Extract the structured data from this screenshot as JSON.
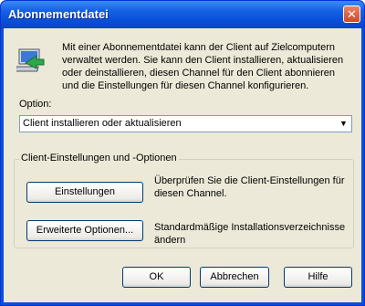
{
  "window": {
    "title": "Abonnementdatei",
    "close_label": "✕"
  },
  "description": "Mit einer Abonnementdatei kann der Client auf Zielcomputern verwaltet werden. Sie kann den Client installieren, aktualisieren oder deinstallieren, diesen Channel für den Client abonnieren und die Einstellungen für diesen Channel konfigurieren.",
  "option": {
    "label": "Option:",
    "selected": "Client installieren oder aktualisieren"
  },
  "group": {
    "label": "Client-Einstellungen und -Optionen",
    "settings_button": "Einstellungen",
    "settings_text": "Überprüfen Sie die Client-Einstellungen für diesen Channel.",
    "advanced_button": "Erweiterte Optionen...",
    "advanced_text": "Standardmäßige Installationsverzeichnisse ändern"
  },
  "footer": {
    "ok": "OK",
    "cancel": "Abbrechen",
    "help": "Hilfe"
  }
}
